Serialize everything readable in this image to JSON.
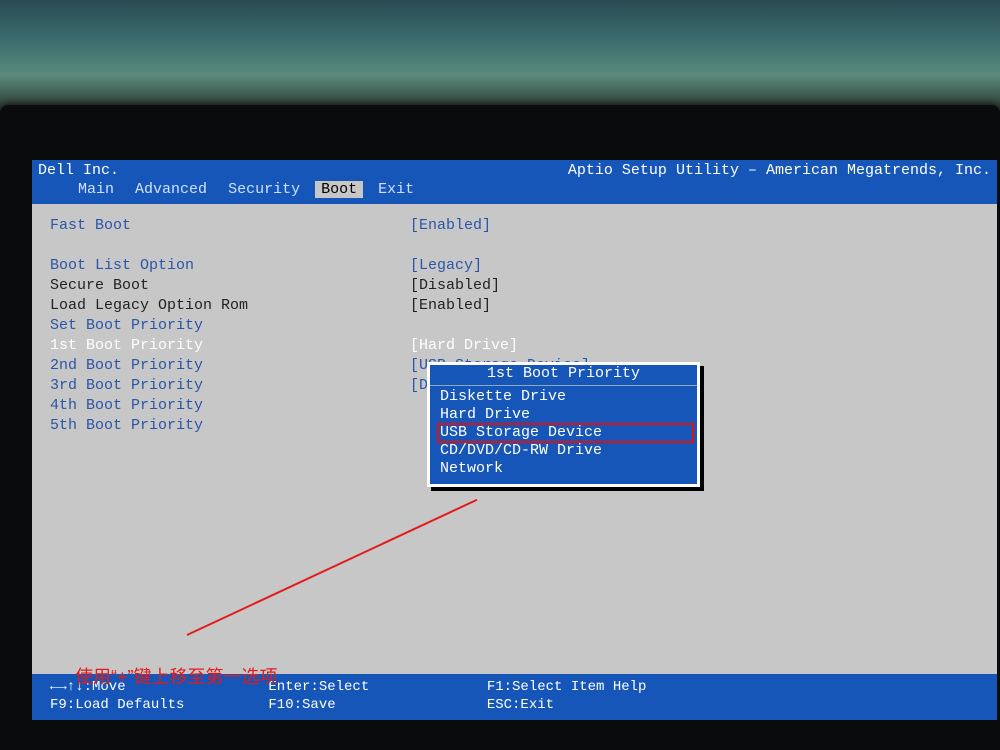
{
  "header": {
    "vendor": "Dell Inc.",
    "utility": "Aptio Setup Utility – American Megatrends, Inc."
  },
  "tabs": [
    "Main",
    "Advanced",
    "Security",
    "Boot",
    "Exit"
  ],
  "active_tab": "Boot",
  "settings": {
    "fast_boot": {
      "label": "Fast Boot",
      "value": "[Enabled]"
    },
    "boot_list_option": {
      "label": "Boot List Option",
      "value": "[Legacy]"
    },
    "secure_boot": {
      "label": "Secure Boot",
      "value": "[Disabled]"
    },
    "load_legacy_rom": {
      "label": "Load Legacy Option Rom",
      "value": "[Enabled]"
    },
    "set_priority": {
      "label": "Set Boot Priority",
      "value": ""
    },
    "p1": {
      "label": "1st Boot Priority",
      "value": "[Hard Drive]"
    },
    "p2": {
      "label": "2nd Boot Priority",
      "value": "[USB Storage Device]"
    },
    "p3": {
      "label": "3rd Boot Priority",
      "value": "[Diskette Drive]"
    },
    "p4": {
      "label": "4th Boot Priority",
      "value": ""
    },
    "p5": {
      "label": "5th Boot Priority",
      "value": ""
    }
  },
  "popup": {
    "title": "1st Boot Priority",
    "items": [
      "Diskette Drive",
      "Hard Drive",
      "USB Storage Device",
      "CD/DVD/CD-RW Drive",
      "Network"
    ],
    "highlight_index": 2
  },
  "footer": {
    "l1a": "←→↑↓:Move",
    "l1b": "Enter:Select",
    "l1c": "F1:Select Item Help",
    "l2a": "F9:Load Defaults",
    "l2b": "F10:Save",
    "l2c": "ESC:Exit"
  },
  "annotation": "使用“+”键上移至第一选项"
}
